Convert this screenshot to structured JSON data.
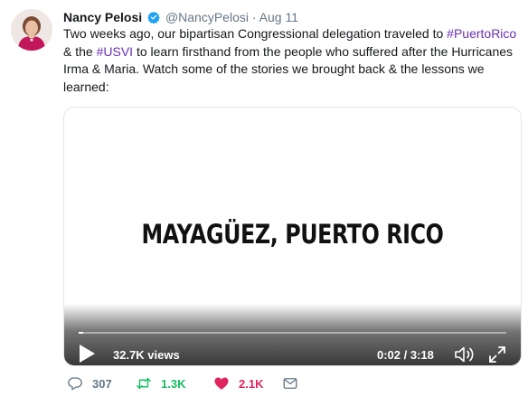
{
  "tweet": {
    "author_name": "Nancy Pelosi",
    "handle": "@NancyPelosi",
    "separator": "·",
    "date": "Aug 11",
    "text_parts": [
      "Two weeks ago, our bipartisan Congressional delegation traveled to ",
      "#PuertoRico",
      " & the ",
      "#USVI",
      " to learn firsthand from the people who suffered after the Hurricanes Irma & Maria. Watch some of the stories we brought back & the lessons we learned:"
    ]
  },
  "video": {
    "title_card": "MAYAGÜEZ, PUERTO RICO",
    "views": "32.7K views",
    "time": "0:02 / 3:18",
    "progress_fraction": 0.01
  },
  "actions": {
    "replies": "307",
    "retweets": "1.3K",
    "likes": "2.1K"
  },
  "colors": {
    "hashtag": "#6a2fb3",
    "verified": "#1da1f2",
    "retweet": "#17bf63",
    "like": "#e0245e",
    "muted": "#657786"
  }
}
